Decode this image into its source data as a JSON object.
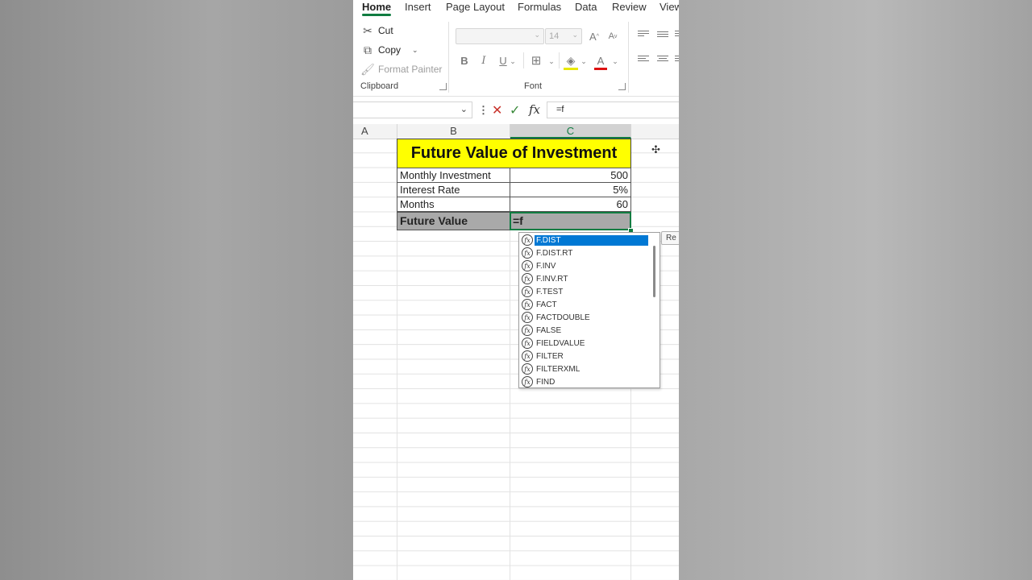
{
  "ribbon_tabs": [
    "Home",
    "Insert",
    "Page Layout",
    "Formulas",
    "Data",
    "Review",
    "View"
  ],
  "clipboard": {
    "cut": "Cut",
    "copy": "Copy",
    "format_painter": "Format Painter",
    "group_label": "Clipboard"
  },
  "font": {
    "family_value": "",
    "size_value": "14",
    "group_label": "Font",
    "bold": "B",
    "italic": "I",
    "underline": "U",
    "grow": "A",
    "shrink": "A",
    "font_color": "A"
  },
  "formula_bar": {
    "name_box": "",
    "formula": "=f"
  },
  "column_headers": [
    "A",
    "B",
    "C"
  ],
  "sheet": {
    "title": "Future Value of Investment",
    "rows": [
      {
        "label": "Monthly Investment",
        "value": "500"
      },
      {
        "label": "Interest Rate",
        "value": "5%"
      },
      {
        "label": "Months",
        "value": "60"
      }
    ],
    "future_value_label": "Future Value",
    "active_cell_text": "=f"
  },
  "autocomplete": [
    "F.DIST",
    "F.DIST.RT",
    "F.INV",
    "F.INV.RT",
    "F.TEST",
    "FACT",
    "FACTDOUBLE",
    "FALSE",
    "FIELDVALUE",
    "FILTER",
    "FILTERXML",
    "FIND"
  ],
  "selected_function": "F.DIST",
  "tooltip_text": "Re",
  "colors": {
    "accent": "#107c41",
    "title_fill": "#ffff00",
    "selection_blue": "#0078d4"
  }
}
